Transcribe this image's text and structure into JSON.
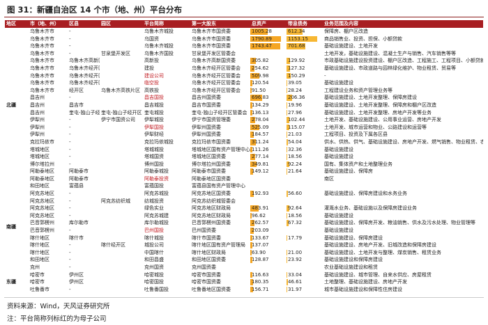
{
  "figure": {
    "title": "图 31：新疆自治区 14 个市（地、州）平台分布",
    "source": "资料来源：Wind，天风证券研究所",
    "note": "注：平台简称列标红的为母子公司"
  },
  "colors": {
    "header_bg": "#a81e22",
    "asset_bar": "#f5a623",
    "debt_bar": "#f7b733",
    "highlight_text": "#c0161c"
  },
  "table": {
    "headers": [
      "地区",
      "市（地、州）",
      "区县",
      "园区",
      "平台简称",
      "第一大股东",
      "总资产",
      "带息债务",
      "业务范围及内容"
    ],
    "max_asset": 1790.89,
    "max_debt": 1153.15,
    "groups": [
      {
        "region": "北疆",
        "rows": [
          {
            "city": "乌鲁木齐市",
            "dist": "-",
            "park": "",
            "plat": "乌鲁木齐城投",
            "share": "乌鲁木齐市国资委",
            "asset": "1005.28",
            "debt": "612.34",
            "biz": "保障房、棚户区改造",
            "red": false
          },
          {
            "city": "乌鲁木齐市",
            "dist": "-",
            "park": "",
            "plat": "乌国资",
            "share": "乌鲁木齐市国资委",
            "asset": "1790.89",
            "debt": "1153.15",
            "biz": "商品销售业、投资、担保、小额贷款",
            "red": false
          },
          {
            "city": "乌鲁木齐市",
            "dist": "-",
            "park": "",
            "plat": "乌鲁木齐城投",
            "share": "乌鲁木齐市国资委",
            "asset": "1743.47",
            "debt": "701.68",
            "biz": "基础设施建设、土地开发",
            "red": false
          },
          {
            "city": "乌鲁木齐市",
            "dist": "-",
            "park": "甘泉堡开发区",
            "plat": "乌鲁木齐国投",
            "share": "甘泉堡开发区管委会",
            "asset": "",
            "debt": "",
            "biz": "土地开发，基础设施建设、混凝土生产与销售、汽车销售等等",
            "red": false
          },
          {
            "city": "乌鲁木齐市",
            "dist": "乌鲁木齐高新区",
            "park": "",
            "plat": "高新投",
            "share": "乌鲁木齐高新国资委",
            "asset": "305.82",
            "debt": "129.92",
            "biz": "市政基础设施建设投资建设、棚户区改造、工程施工、工程项目、小额贷款及担保",
            "red": false
          },
          {
            "city": "乌鲁木齐市",
            "dist": "乌鲁木齐经开区",
            "park": "",
            "plat": "建投",
            "share": "乌鲁木齐经开区管委会",
            "asset": "254.62",
            "debt": "127.32",
            "biz": "基础设施建设、市政道路与园林绿化维护、物业租赁、贸易等",
            "red": false
          },
          {
            "city": "乌鲁木齐市",
            "dist": "乌鲁木齐经开区",
            "park": "",
            "plat": "建设公司",
            "share": "乌鲁木齐经开区管委会",
            "asset": "509.98",
            "debt": "150.29",
            "biz": "-",
            "red": true
          },
          {
            "city": "乌鲁木齐市",
            "dist": "乌鲁木齐经开区",
            "park": "",
            "plat": "临空投",
            "share": "乌鲁木齐经开区管委会",
            "asset": "120.54",
            "debt": "39.05",
            "biz": "基础设施建设",
            "red": true
          },
          {
            "city": "乌鲁木齐市",
            "dist": "经开区",
            "park": "乌鲁木齐高铁片区",
            "plat": "高铁投",
            "share": "乌鲁木齐经开区管委会",
            "asset": "91.50",
            "debt": "28.24",
            "biz": "工程建设业务和资产管理业务等",
            "red": false
          },
          {
            "city": "昌吉州",
            "dist": "-",
            "park": "",
            "plat": "昌吉国投",
            "share": "昌吉州国资委",
            "asset": "696.83",
            "debt": "206.36",
            "biz": "基础设施建设、土地开发整理、保障房建设",
            "red": true
          },
          {
            "city": "昌吉州",
            "dist": "昌吉市",
            "park": "",
            "plat": "昌吉城投",
            "share": "昌吉市国资委",
            "asset": "134.29",
            "debt": "19.96",
            "biz": "基础设施建设、土地开发整理、保障房和棚户区改造",
            "red": false
          },
          {
            "city": "昌吉州",
            "dist": "奎屯-独山子经开区",
            "park": "奎屯-独山子经开区",
            "plat": "奎屯城投",
            "share": "奎屯-独山子经开区管委会",
            "asset": "136.13",
            "debt": "27.96",
            "biz": "基础设施建设、土地开发整理、房地产开发等业务",
            "red": false
          },
          {
            "city": "伊犁州",
            "dist": "-",
            "park": "伊宁市国资公司",
            "plat": "伊犁城投",
            "share": "伊宁市国资管理委",
            "asset": "278.04",
            "debt": "102.44",
            "biz": "土地开发、基础设施建设、公用事业运营、房地产开发",
            "red": false
          },
          {
            "city": "伊犁州",
            "dist": "-",
            "park": "",
            "plat": "伊犁国投",
            "share": "伊犁州国资委",
            "asset": "525.09",
            "debt": "115.07",
            "biz": "土地开发、城市运营和物业、公路建设和运营等",
            "red": true
          },
          {
            "city": "伊犁州",
            "dist": "-",
            "park": "",
            "plat": "伊犁财经",
            "share": "伊犁州国资委",
            "asset": "184.57",
            "debt": "21.03",
            "biz": "工程项目、投资及下属各区县",
            "red": false
          },
          {
            "city": "克拉玛依市",
            "dist": "-",
            "park": "",
            "plat": "克拉玛依城投",
            "share": "克拉玛依市国资委",
            "asset": "311.24",
            "debt": "54.04",
            "biz": "供水、供热、供气、基础设施建设、房地产开发、燃气销售、物业租赁、农业和文化旅游等",
            "red": false
          },
          {
            "city": "塔城地区",
            "dist": "-",
            "park": "",
            "plat": "塔城城投",
            "share": "塔城地区国有资产管理中心",
            "asset": "111.26",
            "debt": "32.36",
            "biz": "基础设施建设",
            "red": false
          },
          {
            "city": "塔城地区",
            "dist": "-",
            "park": "",
            "plat": "塔城国资",
            "share": "塔城地区国资委",
            "asset": "277.14",
            "debt": "18.56",
            "biz": "基础设施建设",
            "red": false
          },
          {
            "city": "博尔塔拉州",
            "dist": "-",
            "park": "",
            "plat": "博州国投",
            "share": "博尔塔拉州国资委",
            "asset": "349.81",
            "debt": "92.24",
            "biz": "国有、集体资产和土地整理业务",
            "red": false
          },
          {
            "city": "阿勒泰地区",
            "dist": "阿勒泰市",
            "park": "",
            "plat": "阿勒泰城投",
            "share": "阿勒泰市国资委",
            "asset": "149.12",
            "debt": "21.64",
            "biz": "基础设施建设、保障房",
            "red": false
          },
          {
            "city": "阿勒泰地区",
            "dist": "阿勒泰市",
            "park": "",
            "plat": "阿勒泰投资",
            "share": "阿勒泰地区国资委",
            "asset": "",
            "debt": "",
            "biz": "南区",
            "red": true
          }
        ]
      },
      {
        "region": "南疆",
        "rows": [
          {
            "city": "和田地区",
            "dist": "富蕴县",
            "park": "",
            "plat": "富蕴国投",
            "share": "富蕴县国有资产管理中心",
            "asset": "",
            "debt": "",
            "biz": "",
            "red": false
          },
          {
            "city": "阿克苏地区",
            "dist": "-",
            "park": "",
            "plat": "阿克苏城投",
            "share": "阿克苏地区国资委",
            "asset": "192.93",
            "debt": "56.60",
            "biz": "基础设施建设、保障房建设和水务业务",
            "red": false
          },
          {
            "city": "阿克苏地区",
            "dist": "-",
            "park": "阿克苏纺织城",
            "plat": "纺城投资",
            "share": "阿克苏纺织城管委会",
            "asset": "",
            "debt": "",
            "biz": "",
            "red": false
          },
          {
            "city": "阿克苏地区",
            "dist": "-",
            "park": "",
            "plat": "绿色实业",
            "share": "阿克苏地区财政局",
            "asset": "483.91",
            "debt": "92.64",
            "biz": "灌溉水业务、基础设施以及保障房建设业务",
            "red": false
          },
          {
            "city": "阿克苏地区",
            "dist": "-",
            "park": "",
            "plat": "阿克苏城建",
            "share": "阿克苏地区财政局",
            "asset": "96.62",
            "debt": "18.56",
            "biz": "基础设施建设",
            "red": false
          },
          {
            "city": "巴音郭楞州",
            "dist": "库尔勒市",
            "park": "",
            "plat": "库尔勒城投",
            "share": "巴音郭楞州国资委",
            "asset": "262.57",
            "debt": "67.32",
            "biz": "基础设施建设、保障房开发、粮油销售、供水及污水处理、物业管理等",
            "red": false
          },
          {
            "city": "巴音郭楞州",
            "dist": "-",
            "park": "",
            "plat": "巴州国投",
            "share": "巴州国资委",
            "asset": "203.09",
            "debt": "",
            "biz": "基础设施建设",
            "red": true
          },
          {
            "city": "喀什地区",
            "dist": "喀什市",
            "park": "",
            "plat": "喀什城投",
            "share": "喀什市国资委",
            "asset": "133.67",
            "debt": "17.79",
            "biz": "基础设施建设、保障房建设",
            "red": false
          },
          {
            "city": "喀什地区",
            "dist": "-",
            "park": "喀什经开区",
            "plat": "城投公司",
            "share": "喀什地区国有资产管理局",
            "asset": "137.07",
            "debt": "",
            "biz": "基础设施建设、房地产开发、旧城改造和保障房建设",
            "red": false
          },
          {
            "city": "喀什地区",
            "dist": "-",
            "park": "",
            "plat": "中国喀什",
            "share": "喀什地区财政局",
            "asset": "63.90",
            "debt": "21.00",
            "biz": "基础设施建设、土地开发与整理、煤炭销售、租赁业务",
            "red": false
          },
          {
            "city": "和田地区",
            "dist": "-",
            "park": "",
            "plat": "和田昌盛",
            "share": "和田地区国资委",
            "asset": "128.87",
            "debt": "23.92",
            "biz": "基础设施建设和保障房建设",
            "red": false
          },
          {
            "city": "克州",
            "dist": "-",
            "park": "",
            "plat": "克州国资",
            "share": "克州国资委",
            "asset": "",
            "debt": "",
            "biz": "农业基础设施建设和租赁",
            "red": false
          }
        ]
      },
      {
        "region": "东疆",
        "rows": [
          {
            "city": "哈密市",
            "dist": "伊州区",
            "park": "",
            "plat": "哈密城投",
            "share": "哈密市国资委",
            "asset": "116.63",
            "debt": "33.04",
            "biz": "基础设施建设、城市管理、自来水供应、房屋租赁",
            "red": false
          },
          {
            "city": "哈密市",
            "dist": "伊州区",
            "park": "",
            "plat": "哈密国投",
            "share": "哈密市国资委",
            "asset": "180.35",
            "debt": "46.61",
            "biz": "土地整理、基础设施建设、房地产开发",
            "red": false
          },
          {
            "city": "吐鲁番市",
            "dist": "-",
            "park": "",
            "plat": "吐鲁番国投",
            "share": "吐鲁番地区国资委",
            "asset": "156.71",
            "debt": "31.97",
            "biz": "城市基础设施建设和保障性住房建设",
            "red": false
          }
        ]
      }
    ]
  }
}
